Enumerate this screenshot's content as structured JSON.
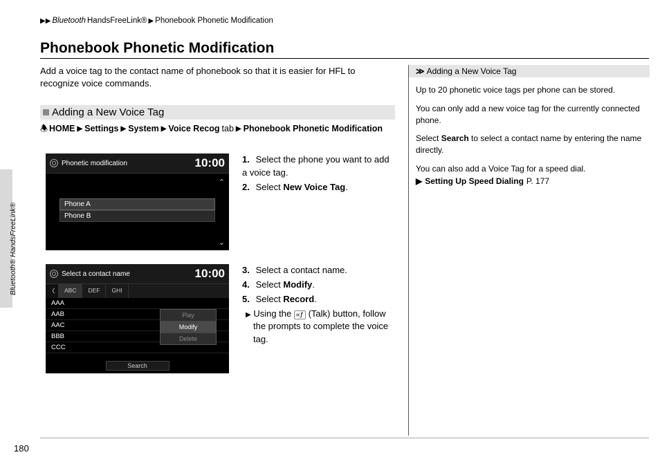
{
  "breadcrumb": {
    "l1": "Bluetooth",
    "reg": "®",
    "l2": " HandsFreeLink®",
    "l3": "Phonebook Phonetic Modification"
  },
  "title": "Phonebook Phonetic Modification",
  "intro": "Add a voice tag to the contact name of phonebook so that it is easier for HFL to recognize voice commands.",
  "side_tab": "Bluetooth® HandsFreeLink®",
  "subhead": "Adding a New Voice Tag",
  "nav": {
    "home": "HOME",
    "settings": "Settings",
    "system": "System",
    "voice": "Voice Recog",
    "tab": " tab",
    "final": "Phonebook Phonetic Modification"
  },
  "screen1": {
    "title": "Phonetic modification",
    "clock": "10:00",
    "rows": [
      "Phone A",
      "Phone B"
    ]
  },
  "screen2": {
    "title": "Select a contact name",
    "clock": "10:00",
    "tabs": [
      "ABC",
      "DEF",
      "GHI"
    ],
    "rows": [
      "AAA",
      "AAB",
      "AAC",
      "BBB",
      "CCC"
    ],
    "popup": [
      "Play",
      "Modify",
      "Delete"
    ],
    "search": "Search"
  },
  "steps1": {
    "s1": "Select the phone you want to add a voice tag.",
    "s2a": "Select ",
    "s2b": "New Voice Tag",
    "s2c": "."
  },
  "steps2": {
    "s3": "Select a contact name.",
    "s4a": "Select ",
    "s4b": "Modify",
    "s4c": ".",
    "s5a": "Select ",
    "s5b": "Record",
    "s5c": ".",
    "sub": "Using the       (Talk) button, follow the prompts to complete the voice tag."
  },
  "right": {
    "head": "Adding a New Voice Tag",
    "p1": "Up to 20 phonetic voice tags per phone can be stored.",
    "p2": "You can only add a new voice tag for the currently connected phone.",
    "p3a": "Select ",
    "p3b": "Search",
    "p3c": " to select a contact name by entering the name directly.",
    "p4": "You can also add a Voice Tag for a speed dial.",
    "ref": "Setting Up Speed Dialing",
    "refpage": "P. 177"
  },
  "pagenum": "180"
}
